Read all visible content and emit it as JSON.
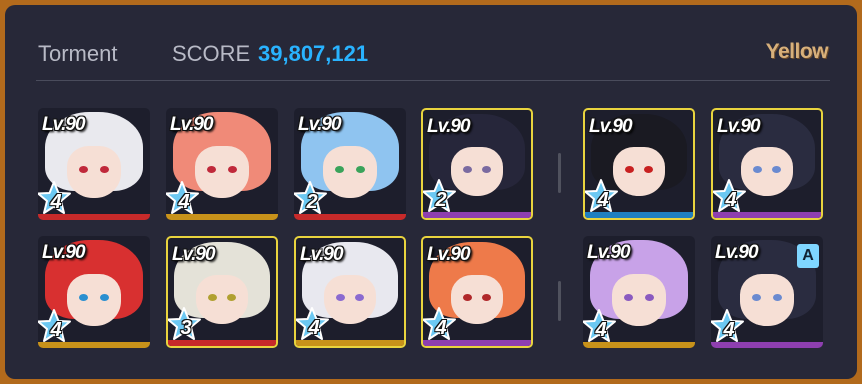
{
  "header": {
    "mode": "Torment",
    "score_label": "SCORE",
    "score_value": "39,807,121",
    "team_label": "Yellow"
  },
  "colors": {
    "frame": "#b26a1c",
    "panel": "#272838",
    "score": "#29b3ff",
    "selected_border": "#e9d43e",
    "bar_red": "#c72a2a",
    "bar_gold": "#c8921a",
    "bar_blue": "#1f7fc0",
    "bar_purple": "#8e3fb0"
  },
  "striker_rows": [
    [
      {
        "level": "Lv.90",
        "star": "4",
        "selected": false,
        "bar": "red",
        "hair": "#e9e9ee",
        "eye": "#c0283a"
      },
      {
        "level": "Lv.90",
        "star": "4",
        "selected": false,
        "bar": "gold",
        "hair": "#f08a78",
        "eye": "#c0283a"
      },
      {
        "level": "Lv.90",
        "star": "2",
        "selected": false,
        "bar": "red",
        "hair": "#8fc4f0",
        "eye": "#3aa35a"
      },
      {
        "level": "Lv.90",
        "star": "2",
        "selected": true,
        "bar": "purple",
        "hair": "#26263a",
        "eye": "#7a6aa0"
      }
    ],
    [
      {
        "level": "Lv.90",
        "star": "4",
        "selected": false,
        "bar": "gold",
        "hair": "#d83030",
        "eye": "#2a8fd0"
      },
      {
        "level": "Lv.90",
        "star": "3",
        "selected": true,
        "bar": "red",
        "hair": "#e4e2d8",
        "eye": "#b0a030"
      },
      {
        "level": "Lv.90",
        "star": "4",
        "selected": true,
        "bar": "gold",
        "hair": "#e8e8ef",
        "eye": "#8a6ad0"
      },
      {
        "level": "Lv.90",
        "star": "4",
        "selected": true,
        "bar": "purple",
        "hair": "#ee7a4a",
        "eye": "#b0282a"
      }
    ]
  ],
  "special_rows": [
    [
      {
        "level": "Lv.90",
        "star": "4",
        "selected": true,
        "bar": "blue",
        "hair": "#1a1a22",
        "eye": "#c82020"
      },
      {
        "level": "Lv.90",
        "star": "4",
        "selected": true,
        "bar": "purple",
        "hair": "#2a2c40",
        "eye": "#6a8ad0"
      }
    ],
    [
      {
        "level": "Lv.90",
        "star": "4",
        "selected": false,
        "bar": "gold",
        "hair": "#c8a2e8",
        "eye": "#8a5ac0"
      },
      {
        "level": "Lv.90",
        "star": "4",
        "selected": false,
        "bar": "purple",
        "hair": "#2a2c40",
        "eye": "#6a8ad0",
        "badge": "A"
      }
    ]
  ]
}
